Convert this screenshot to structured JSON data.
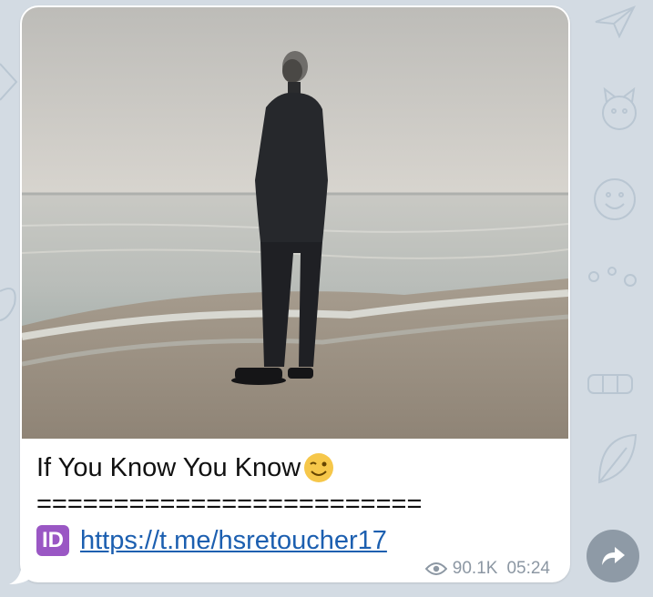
{
  "message": {
    "caption_title": "If You Know You Know",
    "title_emoji": "winking-face",
    "separator": "=========================",
    "badge_text": "ID",
    "link_text": "https://t.me/hsretoucher17",
    "views": "90.1K",
    "time": "05:24"
  },
  "icons": {
    "views": "eye-icon",
    "share": "share-arrow-icon"
  },
  "colors": {
    "link": "#1c5fb0",
    "badge": "#9a57c4",
    "meta": "#8c97a3",
    "share_button": "#8e9aa6"
  }
}
